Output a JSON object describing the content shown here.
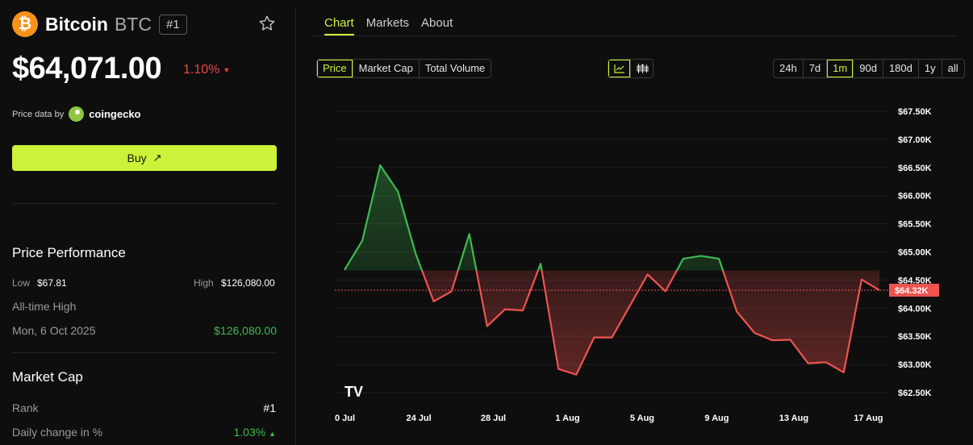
{
  "coin": {
    "logo_glyph": "₿",
    "name": "Bitcoin",
    "symbol": "BTC",
    "rank_badge": "#1",
    "price": "$64,071.00",
    "change": "1.10%",
    "change_dir": "▼"
  },
  "price_source": {
    "prefix": "Price data by",
    "name": "coingecko"
  },
  "buy": {
    "label": "Buy",
    "arrow": "↗"
  },
  "performance": {
    "title": "Price Performance",
    "low_label": "Low",
    "low_value": "$67.81",
    "high_label": "High",
    "high_value": "$126,080.00",
    "ath_label": "All-time High",
    "ath_date": "Mon, 6 Oct 2025",
    "ath_value": "$126,080.00"
  },
  "market_cap": {
    "title": "Market Cap",
    "rank_label": "Rank",
    "rank_value": "#1",
    "daily_label": "Daily change in %",
    "daily_value": "1.03%",
    "daily_dir": "▲"
  },
  "tabs": [
    "Chart",
    "Markets",
    "About"
  ],
  "metric_buttons": [
    "Price",
    "Market Cap",
    "Total Volume"
  ],
  "range_buttons": [
    "24h",
    "7d",
    "1m",
    "90d",
    "180d",
    "1y",
    "all"
  ],
  "active_range": "1m",
  "chart_icons": [
    "line-chart-icon",
    "candlestick-icon"
  ],
  "colors": {
    "accent": "#ccf23a",
    "up": "#3fb950",
    "down": "#ef5350",
    "bg": "#0e0e0e"
  },
  "chart_data": {
    "type": "area",
    "x_labels": [
      "0 Jul",
      "24 Jul",
      "28 Jul",
      "1 Aug",
      "5 Aug",
      "9 Aug",
      "13 Aug",
      "17 Aug"
    ],
    "y_ticks": [
      "$67.50K",
      "$67.00K",
      "$66.50K",
      "$66.00K",
      "$65.50K",
      "$65.00K",
      "$64.50K",
      "$64.00K",
      "$63.50K",
      "$63.00K",
      "$62.50K"
    ],
    "ylim": [
      62.5,
      67.5
    ],
    "baseline": 64.67,
    "current_label": "$64.32K",
    "current_value": 64.32,
    "values": [
      64.68,
      65.2,
      66.54,
      66.07,
      64.96,
      64.12,
      64.3,
      65.32,
      63.68,
      63.98,
      63.96,
      64.79,
      62.92,
      62.82,
      63.48,
      63.48,
      64.04,
      64.6,
      64.3,
      64.88,
      64.93,
      64.88,
      63.94,
      63.56,
      63.43,
      63.44,
      63.02,
      63.04,
      62.86,
      64.51,
      64.32
    ],
    "logo": "TV"
  }
}
